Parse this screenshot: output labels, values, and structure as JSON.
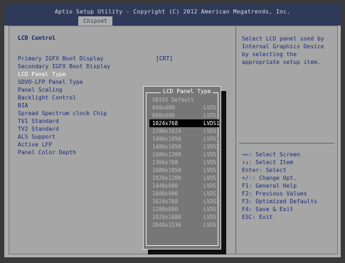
{
  "header": {
    "title": "Aptio Setup Utility - Copyright (C) 2012 American Megatrends, Inc.",
    "active_tab": "Chipset"
  },
  "left": {
    "section_title": "LCD Control",
    "settings": [
      "Primary IGFX Boot Display",
      "Secondary IGFX Boot Display",
      "LCD Panel Type",
      "SDVO-LFP Panel Type",
      "Panel Scaling",
      "Backlight Control",
      "BIA",
      "Spread Spectrum clock Chip",
      "TV1 Standard",
      "TV2 Standard",
      "ALS Support",
      "Active LFP",
      "Panel Color Depth"
    ],
    "primary_value": "[CRT]"
  },
  "popup": {
    "title": "LCD Panel Type",
    "options": [
      {
        "res": "VBIOS Default",
        "type": ""
      },
      {
        "res": "640x480",
        "type": "LVDS"
      },
      {
        "res": "800x600",
        "type": "LVDS"
      },
      {
        "res": "1024x768",
        "type": "LVDS1"
      },
      {
        "res": "1280x1024",
        "type": "LVDS"
      },
      {
        "res": "1400x1050",
        "type": "LVDS1"
      },
      {
        "res": "1400x1050",
        "type": "LVDS2"
      },
      {
        "res": "1600x1200",
        "type": "LVDS"
      },
      {
        "res": "1366x768",
        "type": "LVDS"
      },
      {
        "res": "1680x1050",
        "type": "LVDS"
      },
      {
        "res": "1920x1200",
        "type": "LVDS"
      },
      {
        "res": "1440x900",
        "type": "LVDS"
      },
      {
        "res": "1600x900",
        "type": "LVDS"
      },
      {
        "res": "1024x768",
        "type": "LVDS2"
      },
      {
        "res": "1280x800",
        "type": "LVDS"
      },
      {
        "res": "1920x1080",
        "type": "LVDS"
      },
      {
        "res": "2048x1536",
        "type": "LVDS"
      }
    ],
    "selected_index": 3
  },
  "help": {
    "text": "Select LCD panel used by Internal Graphics Device by selecting the appropriate setup item.",
    "keys": [
      "→←: Select Screen",
      "↑↓: Select Item",
      "Enter: Select",
      "+/-: Change Opt.",
      "F1: General Help",
      "F2: Previous Values",
      "F3: Optimized Defaults",
      "F4: Save & Exit",
      "ESC: Exit"
    ]
  },
  "colors": {
    "header_bg": "#2f3a5a",
    "panel_bg": "#a6a6a6",
    "text_blue": "#1a2a7a",
    "selected_bg": "#000000"
  }
}
